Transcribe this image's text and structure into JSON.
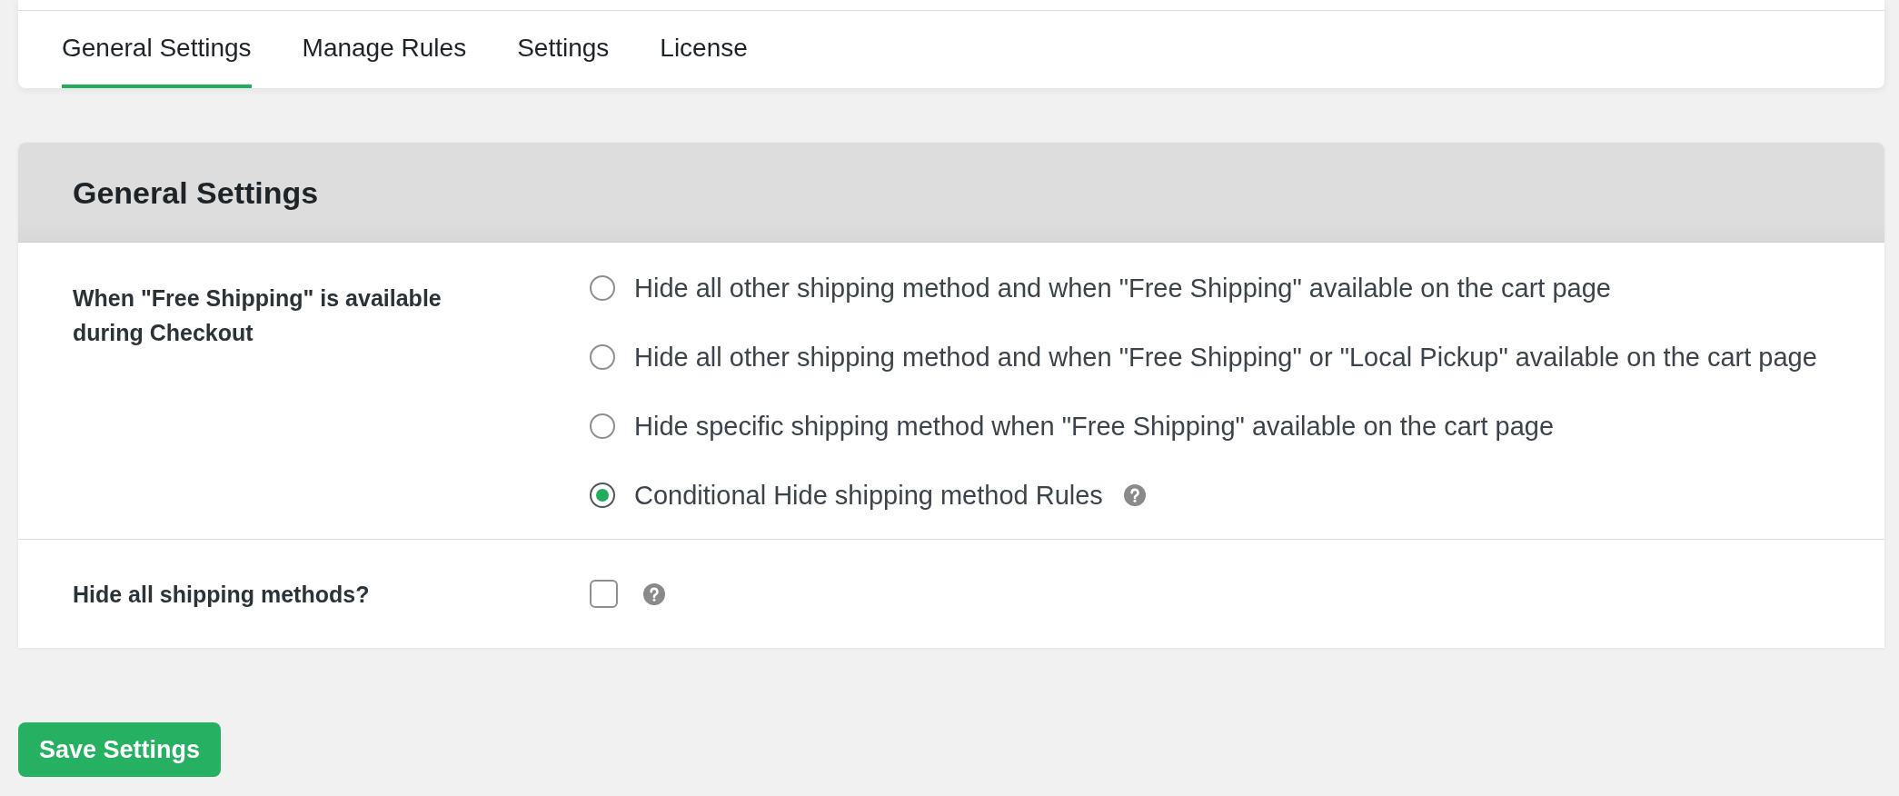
{
  "tabs": [
    {
      "label": "General Settings",
      "selected": true
    },
    {
      "label": "Manage Rules",
      "selected": false
    },
    {
      "label": "Settings",
      "selected": false
    },
    {
      "label": "License",
      "selected": false
    }
  ],
  "panel": {
    "title": "General Settings",
    "fields": [
      {
        "kind": "radio",
        "label": "When \"Free Shipping\" is available during Checkout",
        "options": [
          {
            "label": "Hide all other shipping method and when \"Free Shipping\" available on the cart page",
            "selected": false,
            "help": false
          },
          {
            "label": "Hide all other shipping method and when \"Free Shipping\" or \"Local Pickup\" available on the cart page",
            "selected": false,
            "help": false
          },
          {
            "label": "Hide specific shipping method when \"Free Shipping\" available on the cart page",
            "selected": false,
            "help": false
          },
          {
            "label": "Conditional Hide shipping method Rules",
            "selected": true,
            "help": true
          }
        ]
      },
      {
        "kind": "checkbox",
        "label": "Hide all shipping methods?",
        "checked": false,
        "help": true
      }
    ]
  },
  "save_button": {
    "label": "Save Settings"
  }
}
